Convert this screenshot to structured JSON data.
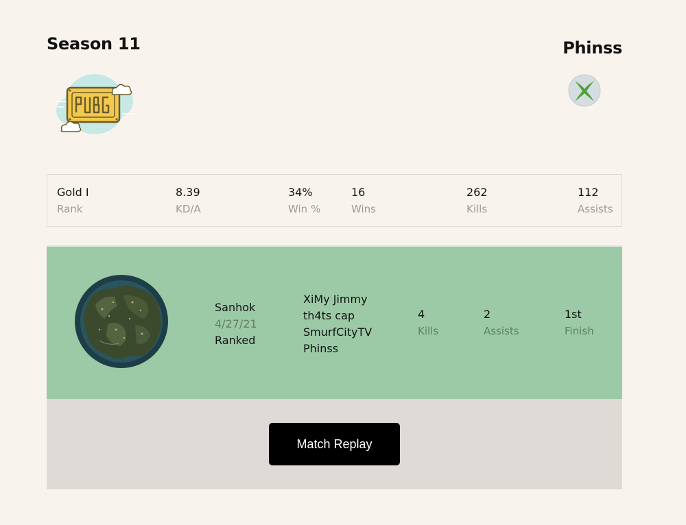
{
  "header": {
    "season_title": "Season 11",
    "player_name": "Phinss",
    "game_logo_icon": "pubg-logo-icon",
    "platform_icon": "xbox-icon"
  },
  "season_stats": [
    {
      "value": "Gold I",
      "label": "Rank"
    },
    {
      "value": "8.39",
      "label": "KD/A"
    },
    {
      "value": "34%",
      "label": "Win %"
    },
    {
      "value": "16",
      "label": "Wins"
    },
    {
      "value": "262",
      "label": "Kills"
    },
    {
      "value": "112",
      "label": "Assists"
    }
  ],
  "match": {
    "map_name": "Sanhok",
    "date": "4/27/21",
    "mode": "Ranked",
    "team": [
      "XiMy Jimmy",
      "th4ts cap",
      "SmurfCityTV",
      "Phinss"
    ],
    "stats": [
      {
        "value": "4",
        "label": "Kills"
      },
      {
        "value": "2",
        "label": "Assists"
      },
      {
        "value": "1st",
        "label": "Finish"
      }
    ],
    "card_color": "#9ccaa6"
  },
  "replay_button_label": "Match Replay"
}
